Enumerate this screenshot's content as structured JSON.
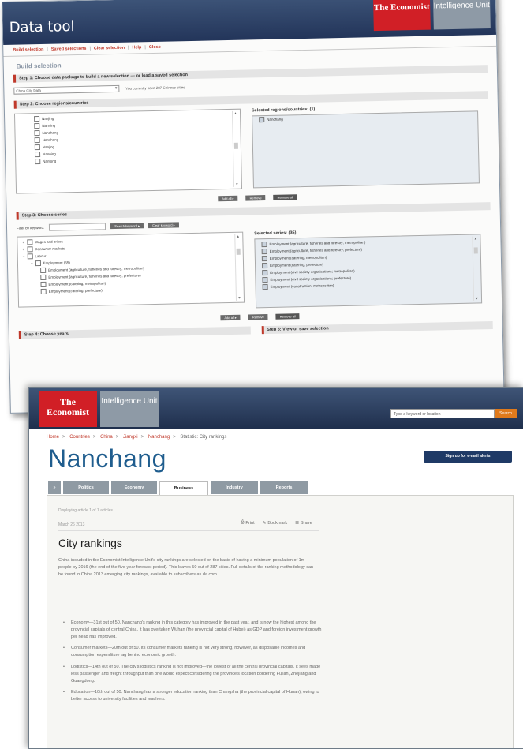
{
  "datatool": {
    "title": "Data tool",
    "logo_economist": "The Economist",
    "logo_eiu": "Intelligence Unit",
    "menu": [
      "Build selection",
      "Saved selections",
      "Clear selection",
      "Help",
      "Close"
    ],
    "build_heading": "Build selection",
    "step1": {
      "label": "Step 1: Choose data package to build a new selection — or load a saved selection",
      "select_value": "China City Data",
      "note": "You currently have 287 Chinese cities"
    },
    "step2": {
      "label": "Step 2: Choose regions/countries",
      "list": [
        "Nanjing",
        "Nanning",
        "Nanchang",
        "Nanchong",
        "Nanjing",
        "Nanning",
        "Nantong"
      ],
      "selected_label": "Selected regions/countries: (1)",
      "selected": [
        "Nanchang"
      ],
      "buttons": [
        "Add all ▸",
        "Remove",
        "Remove all"
      ]
    },
    "step3": {
      "label": "Step 3: Choose series",
      "filter_label": "Filter by keyword:",
      "filter_buttons": [
        "Search keyword ▸",
        "Clear keyword ▸"
      ],
      "tree": [
        "Wages and prices",
        "Consumer markets",
        "Labour",
        "Employment (65)",
        "Employment (agriculture, fisheries and forestry; metropolitan)",
        "Employment (agriculture, fisheries and forestry; prefecture)",
        "Employment (catering; metropolitan)",
        "Employment (catering; prefecture)"
      ],
      "selected_label": "Selected series: (35)",
      "selected": [
        "Employment (agriculture, fisheries and forestry; metropolitan)",
        "Employment (agriculture, fisheries and forestry; prefecture)",
        "Employment (catering; metropolitan)",
        "Employment (catering; prefecture)",
        "Employment (civil society organisations; metropolitan)",
        "Employment (civil society organisations; prefecture)",
        "Employment (construction; metropolitan)"
      ],
      "buttons": [
        "Add all ▸",
        "Remove",
        "Remove all"
      ]
    },
    "step4": {
      "label": "Step 4: Choose years"
    },
    "step5": {
      "label": "Step 5: View or save selection"
    }
  },
  "citypage": {
    "logo_economist": "The Economist",
    "logo_eiu": "Intelligence Unit",
    "search_placeholder": "Type a keyword or location",
    "search_button": "Search",
    "breadcrumbs": [
      "Home",
      "Countries",
      "China",
      "Jiangxi",
      "Nanchang",
      "Statistic: City rankings"
    ],
    "title": "Nanchang",
    "signup": "Sign up for e-mail alerts",
    "tabs": [
      "»",
      "Politics",
      "Economy",
      "Business",
      "Industry",
      "Reports"
    ],
    "active_tab": "Business",
    "meta": "Displaying article 1 of 1 articles",
    "date": "March 26 2013",
    "tools": [
      "Print",
      "Bookmark",
      "Share"
    ],
    "heading": "City rankings",
    "intro": "China included in the Economist Intelligence Unit's city rankings are selected on the basis of having a minimum population of 1m people by 2016 (the end of the five-year forecast period). This leaves 50 out of 287 cities. Full details of the ranking methodology can be found in China 2013 emerging city rankings, available to subscribers as da.com.",
    "bullets": [
      "Economy—31st out of 50. Nanchang's ranking in this category has improved in the past year, and is now the highest among the provincial capitals of central China. It has overtaken Wuhan (the provincial capital of Hubei) as GDP and foreign investment growth per head has improved.",
      "Consumer markets—20th out of 50. Its consumer markets ranking is not very strong, however, as disposable incomes and consumption expenditure lag behind economic growth.",
      "Logistics—14th out of 50. The city's logistics ranking is not improved—the lowest of all the central provincial capitals. It sees made less passenger and freight throughput than one would expect considering the province's location bordering Fujian, Zhejiang and Guangdong.",
      "Education—10th out of 50. Nanchang has a stronger education ranking than Changsha (the provincial capital of Hunan), owing to better access to university facilities and teachers."
    ]
  }
}
